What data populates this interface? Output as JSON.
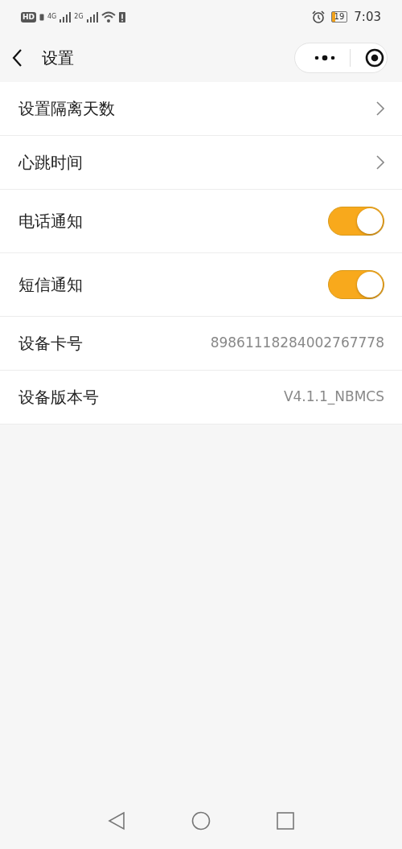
{
  "status_bar": {
    "hd": "HD",
    "networks": [
      "4G",
      "2G"
    ],
    "battery": "19",
    "time": "7:03"
  },
  "header": {
    "title": "设置"
  },
  "rows": [
    {
      "kind": "link",
      "label": "设置隔离天数"
    },
    {
      "kind": "link",
      "label": "心跳时间"
    },
    {
      "kind": "toggle",
      "label": "电话通知",
      "on": true
    },
    {
      "kind": "toggle",
      "label": "短信通知",
      "on": true
    },
    {
      "kind": "value",
      "label": "设备卡号",
      "value": "89861118284002767778"
    },
    {
      "kind": "value",
      "label": "设备版本号",
      "value": "V4.1.1_NBMCS"
    }
  ]
}
